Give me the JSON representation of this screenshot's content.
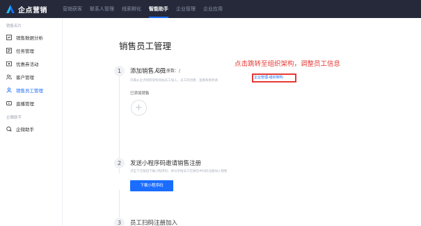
{
  "topbar": {
    "logo_text": "企点营销",
    "nav": [
      "营销获客",
      "联系人管理",
      "线索孵化",
      "智能助手",
      "企业管理",
      "企业应用"
    ],
    "active_index": 3
  },
  "sidebar": {
    "sections": [
      {
        "title": "销售名片",
        "items": [
          {
            "label": "销售数据分析",
            "icon": "chart-icon"
          },
          {
            "label": "任务管理",
            "icon": "task-icon"
          },
          {
            "label": "优惠券活动",
            "icon": "coupon-icon"
          },
          {
            "label": "客户管理",
            "icon": "customer-icon"
          },
          {
            "label": "销售员工管理",
            "icon": "staff-icon",
            "active": true
          },
          {
            "label": "直播管理",
            "icon": "live-icon"
          }
        ]
      },
      {
        "title": "企微助手",
        "items": [
          {
            "label": "企微助手",
            "icon": "wecom-icon"
          }
        ]
      }
    ]
  },
  "main": {
    "title": "销售员工管理",
    "steps": [
      {
        "num": "1",
        "title": "添加销售人员",
        "desc": "可邀从企点组织架构添加员工加入，员工的创建、查看和修改请",
        "registered_label": "注册数：/"
      },
      {
        "num": "2",
        "title": "发送小程序码邀请销售注册",
        "desc": "点击下方按钮下载小程序码，并分享给员工在微信中扫码注册加入销售"
      },
      {
        "num": "3",
        "title": "员工扫码注册加入"
      }
    ],
    "org_link": "企业管理-组织架构",
    "annotation": "点击跳转至组织架构，调整员工信息",
    "added_label": "已添加销售",
    "add_symbol": "+",
    "download_button": "下载小程序码"
  },
  "colors": {
    "topbar_bg": "#25293a",
    "accent": "#1a6dff",
    "annotation_red": "#e53935"
  }
}
